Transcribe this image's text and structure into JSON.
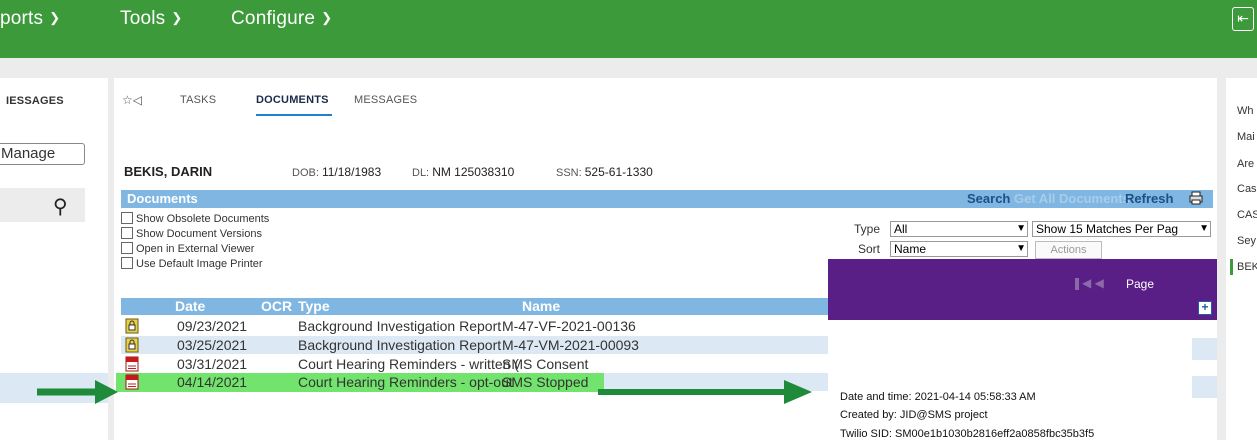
{
  "topbar": {
    "menus": [
      {
        "label": "ports"
      },
      {
        "label": "Tools"
      },
      {
        "label": "Configure"
      }
    ]
  },
  "left_panel": {
    "messages_label": "IESSAGES",
    "manage_label": "Manage"
  },
  "right_panel": {
    "items": [
      "Wh",
      "Mai",
      "Are",
      "Cas",
      "CAS",
      "Sey",
      "BEK"
    ]
  },
  "tabs": [
    {
      "label": "TASKS"
    },
    {
      "label": "DOCUMENTS"
    },
    {
      "label": "MESSAGES"
    }
  ],
  "patient": {
    "name": "BEKIS, DARIN",
    "dob_label": "DOB:",
    "dob": "11/18/1983",
    "dl_label": "DL:",
    "dl": "NM 125038310",
    "ssn_label": "SSN:",
    "ssn": "525-61-1330"
  },
  "documents": {
    "title": "Documents",
    "search_label": "Search",
    "get_all_label": "Get All Documents",
    "refresh_label": "Refresh",
    "options": [
      "Show Obsolete Documents",
      "Show Document Versions",
      "Open in External Viewer",
      "Use Default Image Printer"
    ],
    "type_label": "Type",
    "type_value": "All",
    "show_matches_value": "Show 15 Matches Per Pag",
    "sort_label": "Sort",
    "sort_value": "Name",
    "actions_label": "Actions",
    "columns": {
      "date": "Date",
      "ocr": "OCR",
      "type": "Type",
      "name": "Name"
    },
    "rows": [
      {
        "date": "09/23/2021",
        "type": "Background Investigation Report",
        "name": "M-47-VF-2021-00136",
        "icon": "lock-doc-icon"
      },
      {
        "date": "03/25/2021",
        "type": "Background Investigation Report",
        "name": "M-47-VM-2021-00093",
        "icon": "lock-doc-icon"
      },
      {
        "date": "03/31/2021",
        "type": "Court Hearing Reminders - written (",
        "name": "SMS Consent",
        "icon": "pdf-icon"
      },
      {
        "date": "04/14/2021",
        "type": "Court Hearing Reminders - opt-out",
        "name": "SMS Stopped",
        "icon": "pdf-icon"
      }
    ]
  },
  "popup": {
    "page_label": "Page",
    "lines": [
      "Date and time: 2021-04-14 05:58:33 AM",
      "Created by: JID@SMS project",
      "Twilio SID: SM00e1b1030b2816eff2a0858fbc35b3f5"
    ]
  },
  "colors": {
    "topbar": "#3c9a3a",
    "header_blue": "#7fb6e2",
    "highlight_green": "#72e36c",
    "popup_purple": "#5a1e87",
    "arrow_green": "#1e8a3a"
  }
}
